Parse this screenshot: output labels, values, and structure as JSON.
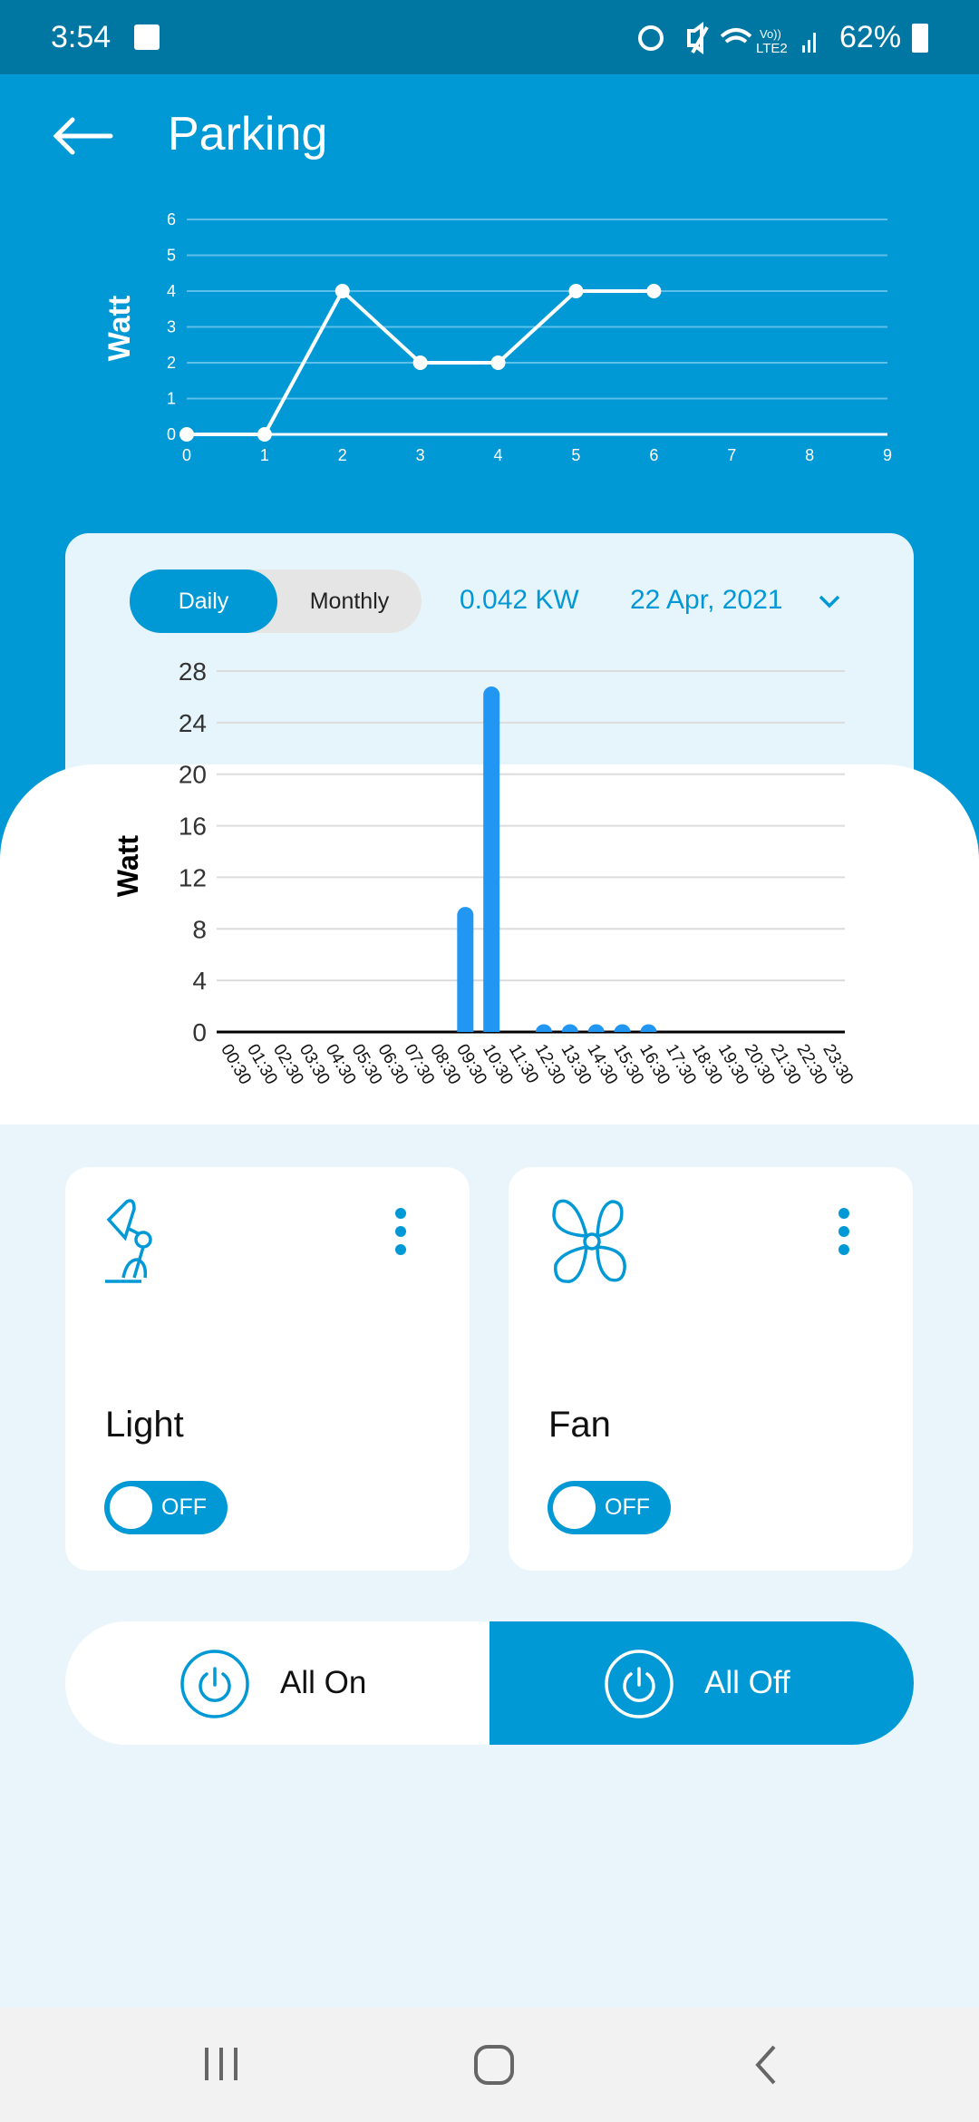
{
  "status_bar": {
    "time": "3:54",
    "battery": "62%",
    "network": "LTE2",
    "icons": [
      "gallery-icon",
      "alarm-icon",
      "mute-icon",
      "wifi-icon",
      "signal-icon",
      "battery-icon"
    ]
  },
  "header": {
    "title": "Parking",
    "back_icon": "arrow-left-icon"
  },
  "colors": {
    "primary": "#0099d6",
    "status_bar": "#0077a3",
    "bar": "#2196f3",
    "background": "#e9f5fb"
  },
  "chart_data": [
    {
      "type": "line",
      "ylabel": "Watt",
      "x": [
        0,
        1,
        2,
        3,
        4,
        5,
        6
      ],
      "values": [
        0,
        0,
        4,
        2,
        2,
        4,
        4
      ],
      "xlim": [
        0,
        9
      ],
      "ylim": [
        0,
        6
      ],
      "xticks": [
        0,
        1,
        2,
        3,
        4,
        5,
        6,
        7,
        8,
        9
      ],
      "yticks": [
        0,
        1,
        2,
        3,
        4,
        5,
        6
      ],
      "grid": true
    },
    {
      "type": "bar",
      "ylabel": "Watt",
      "categories": [
        "00:30",
        "01:30",
        "02:30",
        "03:30",
        "04:30",
        "05:30",
        "06:30",
        "07:30",
        "08:30",
        "09:30",
        "10:30",
        "11:30",
        "12:30",
        "13:30",
        "14:30",
        "15:30",
        "16:30",
        "17:30",
        "18:30",
        "19:30",
        "20:30",
        "21:30",
        "22:30",
        "23:30"
      ],
      "values": [
        0,
        0,
        0,
        0,
        0,
        0,
        0,
        0,
        0,
        9.7,
        26.8,
        0,
        0.6,
        0.6,
        0.6,
        0.6,
        0.6,
        0,
        0,
        0,
        0,
        0,
        0,
        0
      ],
      "ylim": [
        0,
        28
      ],
      "yticks": [
        0,
        4,
        8,
        12,
        16,
        20,
        24,
        28
      ],
      "grid": true
    }
  ],
  "usage": {
    "tabs": [
      "Daily",
      "Monthly"
    ],
    "active_tab": "Daily",
    "total": "0.042 KW",
    "date": "22 Apr, 2021"
  },
  "devices": [
    {
      "name": "Light",
      "icon": "desk-lamp-icon",
      "state": "OFF"
    },
    {
      "name": "Fan",
      "icon": "fan-icon",
      "state": "OFF"
    }
  ],
  "controls": {
    "all_on": "All On",
    "all_off": "All Off"
  }
}
